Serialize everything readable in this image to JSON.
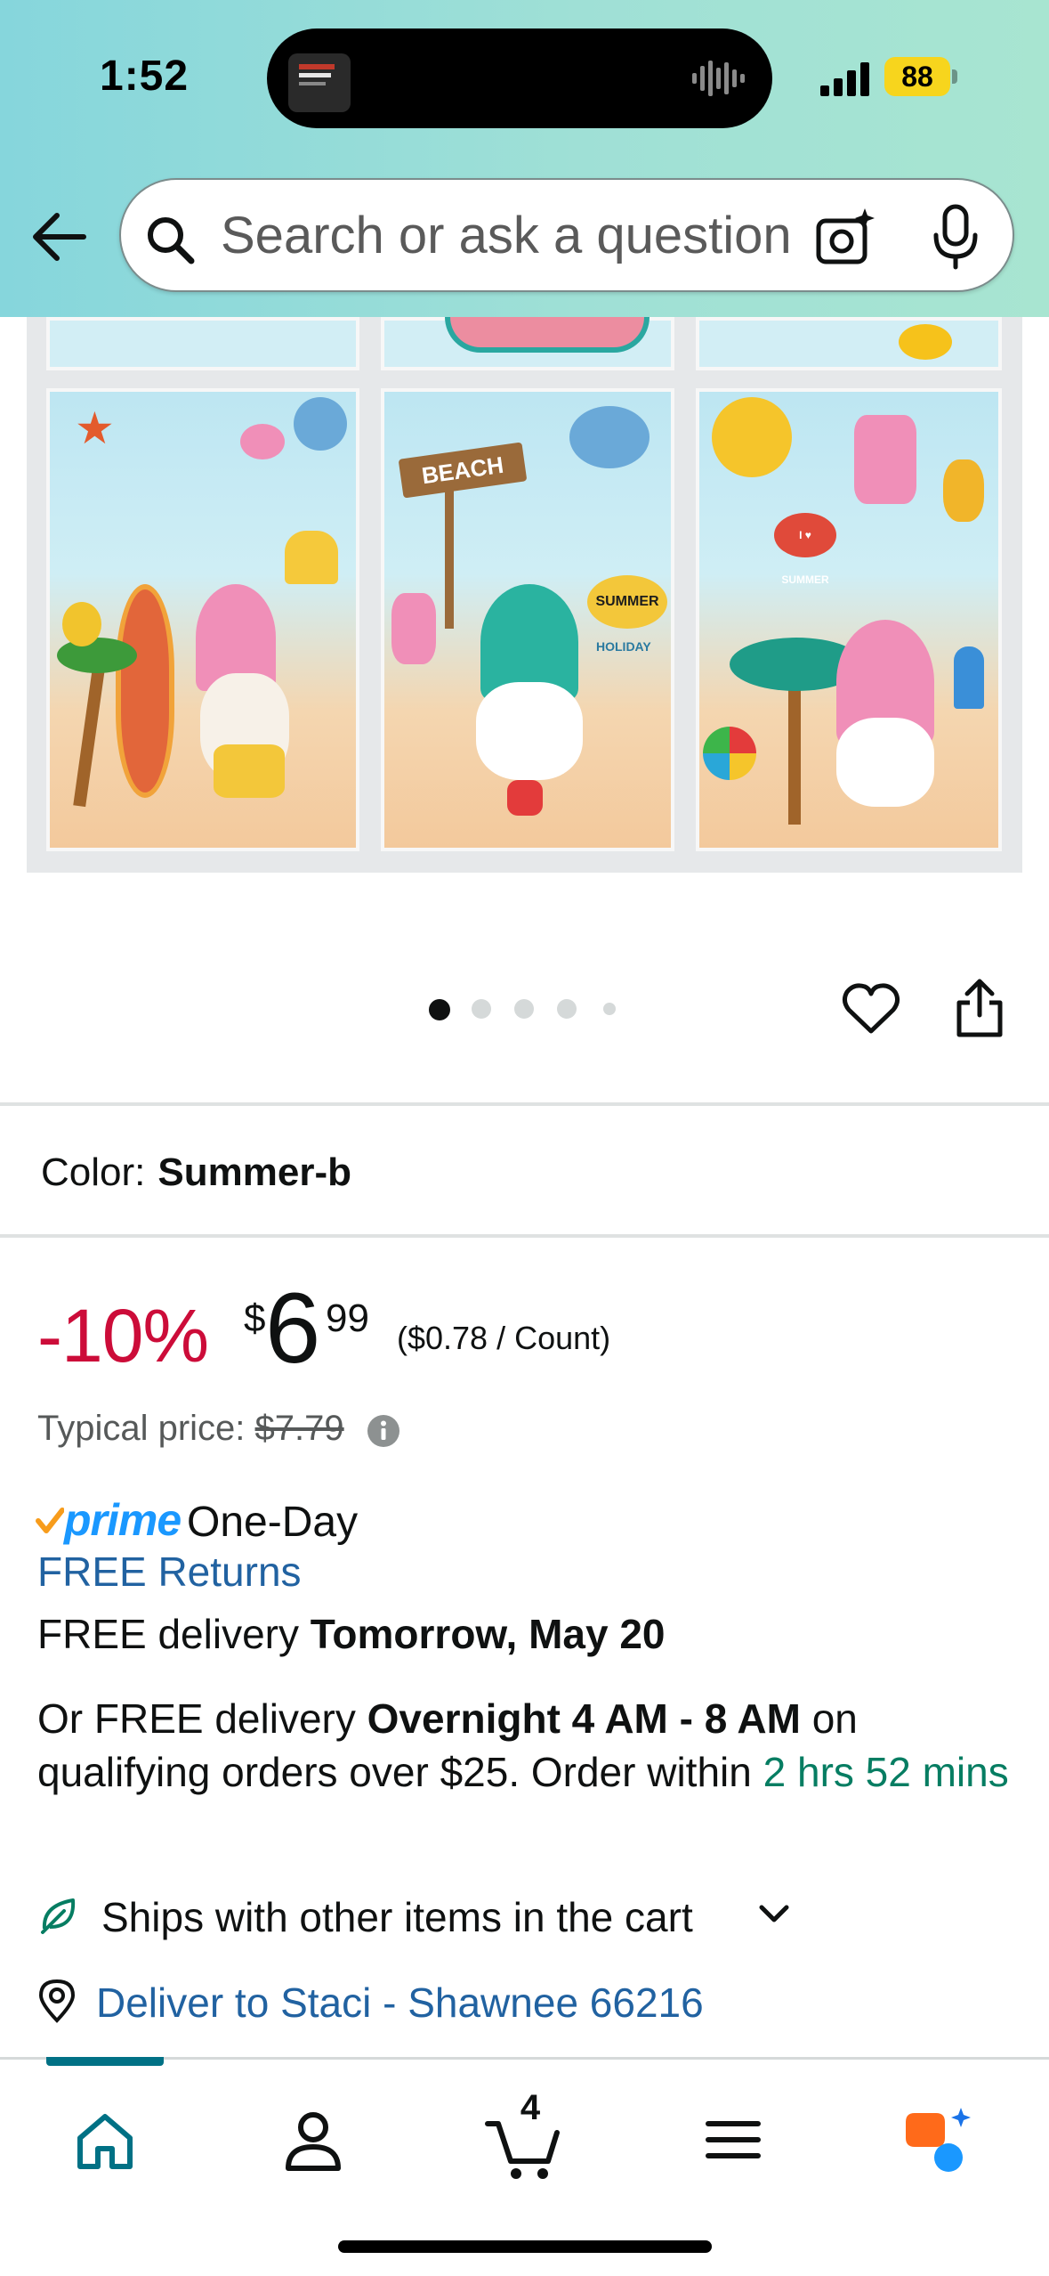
{
  "status_bar": {
    "time": "1:52",
    "battery": "88",
    "battery_color": "#f7d51d"
  },
  "search": {
    "placeholder": "Search or ask a question",
    "icons": [
      "back-arrow-icon",
      "search-icon",
      "camera-sparkle-icon",
      "microphone-icon"
    ]
  },
  "carousel": {
    "dot_count": 5,
    "active_dot": 0,
    "actions": [
      "heart-icon",
      "share-icon"
    ]
  },
  "product_image": {
    "sign_text": "BEACH",
    "hat_text": "SUMMER",
    "hat_subtext": "HOLIDAY",
    "crab_text": "I ♥ SUMMER"
  },
  "variant": {
    "label": "Color:",
    "value": "Summer-b"
  },
  "price": {
    "discount": "-10%",
    "symbol": "$",
    "whole": "6",
    "fraction": "99",
    "unit_price": "($0.78 / Count)",
    "typical_label": "Typical price:",
    "typical_value": "$7.79",
    "discount_color": "#cc0c39"
  },
  "delivery": {
    "prime_label": "prime",
    "prime_suffix": "One-Day",
    "free_returns": "FREE Returns",
    "free_delivery_prefix": "FREE delivery",
    "free_delivery_date": "Tomorrow, May 20",
    "overnight_prefix": "Or FREE delivery",
    "overnight_window": "Overnight 4 AM - 8 AM",
    "overnight_mid": "on qualifying orders over $25. Order within",
    "countdown": "2 hrs 52 mins",
    "ships_with": "Ships with other items in the cart",
    "deliver_to": "Deliver to Staci - Shawnee 66216",
    "link_color": "#2162a1",
    "green_color": "#067d62",
    "prime_color": "#1a98ff"
  },
  "bottom_nav": {
    "items": [
      "home-icon",
      "account-icon",
      "cart-icon",
      "menu-icon",
      "rufus-icon"
    ],
    "cart_count": "4",
    "active_color": "#007185"
  }
}
